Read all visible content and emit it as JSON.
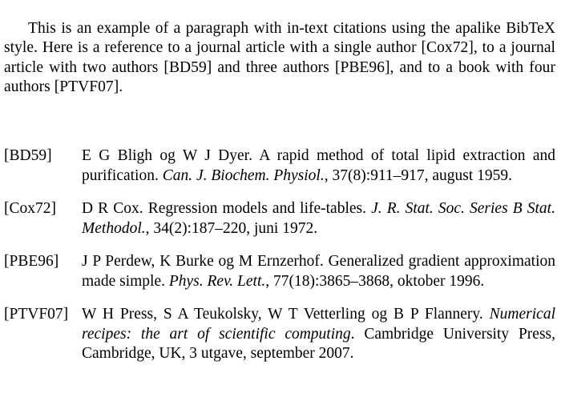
{
  "paragraph": {
    "parts": [
      "This is an example of a paragraph with in-text citations using the apalike BibTeX style. Here is a reference to a journal article with a single author ",
      "[Cox72]",
      ", to a journal article with two authors ",
      "[BD59]",
      " and three authors ",
      "[PBE96]",
      ", and to a book with four authors ",
      "[PTVF07]",
      "."
    ]
  },
  "bibliography": [
    {
      "key": "[BD59]",
      "authors": "E G Bligh og W J Dyer. ",
      "title": "A rapid method of total lipid extraction and purification. ",
      "venue": "Can. J. Biochem. Physiol.",
      "rest": ", 37(8):911–917, august 1959."
    },
    {
      "key": "[Cox72]",
      "authors": "D R Cox. ",
      "title": "Regression models and life-tables. ",
      "venue": "J. R. Stat. Soc. Series B Stat. Methodol.",
      "rest": ", 34(2):187–220, juni 1972."
    },
    {
      "key": "[PBE96]",
      "authors": "J P Perdew, K Burke og M Ernzerhof. ",
      "title": "Generalized gradient approximation made simple. ",
      "venue": "Phys. Rev. Lett.",
      "rest": ", 77(18):3865–3868, oktober 1996."
    },
    {
      "key": "[PTVF07]",
      "authors": "W H Press, S A Teukolsky, W T Vetterling og B P Flannery. ",
      "title": "",
      "venue": "Numerical recipes: the art of scientific computing",
      "rest": ". Cambridge University Press, Cambridge, UK, 3 utgave, september 2007."
    }
  ]
}
